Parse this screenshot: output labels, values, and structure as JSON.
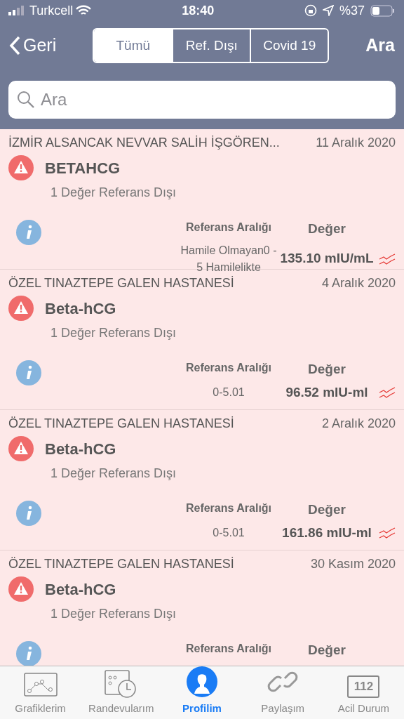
{
  "status_bar": {
    "carrier": "Turkcell",
    "time": "18:40",
    "battery": "%37"
  },
  "nav": {
    "back": "Geri",
    "search": "Ara"
  },
  "segments": [
    {
      "label": "Tümü",
      "selected": true
    },
    {
      "label": "Ref. Dışı",
      "selected": false
    },
    {
      "label": "Covid 19",
      "selected": false
    }
  ],
  "search": {
    "placeholder": "Ara"
  },
  "results": [
    {
      "hospital": "İZMİR ALSANCAK NEVVAR SALİH İŞGÖREN...",
      "date": "11 Aralık 2020",
      "test": "BETAHCG",
      "note": "1 Değer Referans Dışı",
      "range_label": "Referans Aralığı",
      "value_label": "Değer",
      "range": "Hamile Olmayan0 - 5 Hamilelikte",
      "value": "135.10 mIU/mL"
    },
    {
      "hospital": "ÖZEL TINAZTEPE GALEN HASTANESİ",
      "date": "4 Aralık 2020",
      "test": "Beta-hCG",
      "note": "1 Değer Referans Dışı",
      "range_label": "Referans Aralığı",
      "value_label": "Değer",
      "range": "0-5.01",
      "value": "96.52 mIU-ml"
    },
    {
      "hospital": "ÖZEL TINAZTEPE GALEN HASTANESİ",
      "date": "2 Aralık 2020",
      "test": "Beta-hCG",
      "note": "1 Değer Referans Dışı",
      "range_label": "Referans Aralığı",
      "value_label": "Değer",
      "range": "0-5.01",
      "value": "161.86 mIU-ml"
    },
    {
      "hospital": "ÖZEL TINAZTEPE GALEN HASTANESİ",
      "date": "30 Kasım 2020",
      "test": "Beta-hCG",
      "note": "1 Değer Referans Dışı",
      "range_label": "Referans Aralığı",
      "value_label": "Değer"
    }
  ],
  "tab_bar": [
    {
      "kind": "chart",
      "label": "Grafiklerim",
      "selected": false
    },
    {
      "kind": "calendar",
      "label": "Randevularım",
      "selected": false
    },
    {
      "kind": "profile",
      "label": "Profilim",
      "selected": true
    },
    {
      "kind": "link",
      "label": "Paylaşım",
      "selected": false
    },
    {
      "kind": "emergency",
      "label": "Acil Durum",
      "icon_text": "112",
      "selected": false
    }
  ]
}
